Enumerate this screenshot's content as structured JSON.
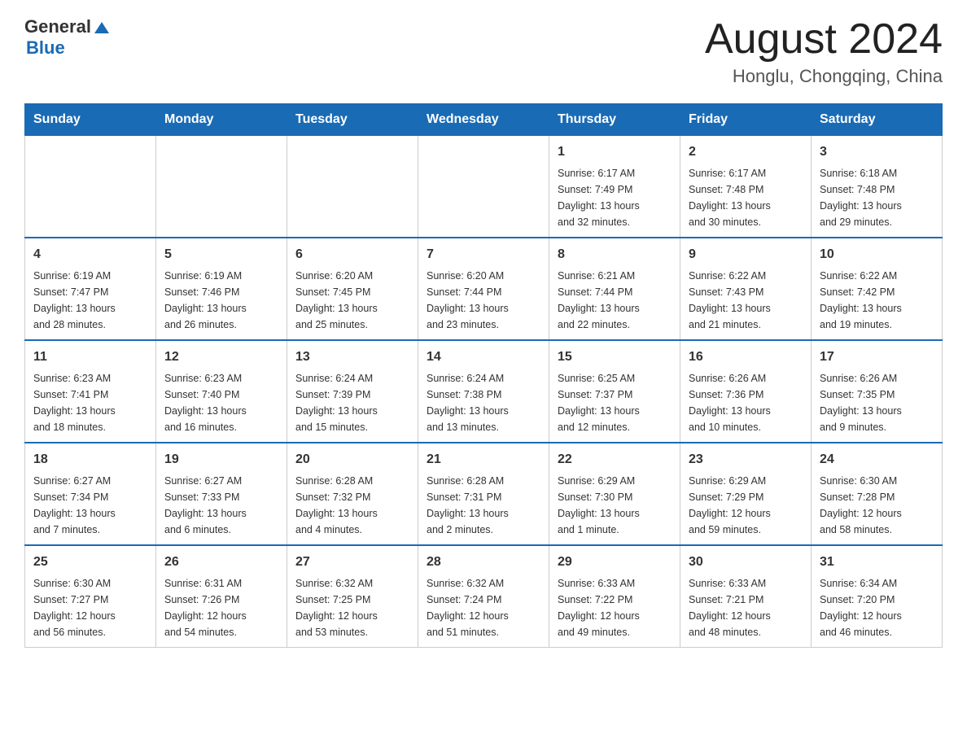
{
  "header": {
    "logo_general": "General",
    "logo_arrow": "▶",
    "logo_blue": "Blue",
    "title": "August 2024",
    "subtitle": "Honglu, Chongqing, China"
  },
  "calendar": {
    "days_of_week": [
      "Sunday",
      "Monday",
      "Tuesday",
      "Wednesday",
      "Thursday",
      "Friday",
      "Saturday"
    ],
    "weeks": [
      [
        {
          "day": "",
          "info": ""
        },
        {
          "day": "",
          "info": ""
        },
        {
          "day": "",
          "info": ""
        },
        {
          "day": "",
          "info": ""
        },
        {
          "day": "1",
          "info": "Sunrise: 6:17 AM\nSunset: 7:49 PM\nDaylight: 13 hours\nand 32 minutes."
        },
        {
          "day": "2",
          "info": "Sunrise: 6:17 AM\nSunset: 7:48 PM\nDaylight: 13 hours\nand 30 minutes."
        },
        {
          "day": "3",
          "info": "Sunrise: 6:18 AM\nSunset: 7:48 PM\nDaylight: 13 hours\nand 29 minutes."
        }
      ],
      [
        {
          "day": "4",
          "info": "Sunrise: 6:19 AM\nSunset: 7:47 PM\nDaylight: 13 hours\nand 28 minutes."
        },
        {
          "day": "5",
          "info": "Sunrise: 6:19 AM\nSunset: 7:46 PM\nDaylight: 13 hours\nand 26 minutes."
        },
        {
          "day": "6",
          "info": "Sunrise: 6:20 AM\nSunset: 7:45 PM\nDaylight: 13 hours\nand 25 minutes."
        },
        {
          "day": "7",
          "info": "Sunrise: 6:20 AM\nSunset: 7:44 PM\nDaylight: 13 hours\nand 23 minutes."
        },
        {
          "day": "8",
          "info": "Sunrise: 6:21 AM\nSunset: 7:44 PM\nDaylight: 13 hours\nand 22 minutes."
        },
        {
          "day": "9",
          "info": "Sunrise: 6:22 AM\nSunset: 7:43 PM\nDaylight: 13 hours\nand 21 minutes."
        },
        {
          "day": "10",
          "info": "Sunrise: 6:22 AM\nSunset: 7:42 PM\nDaylight: 13 hours\nand 19 minutes."
        }
      ],
      [
        {
          "day": "11",
          "info": "Sunrise: 6:23 AM\nSunset: 7:41 PM\nDaylight: 13 hours\nand 18 minutes."
        },
        {
          "day": "12",
          "info": "Sunrise: 6:23 AM\nSunset: 7:40 PM\nDaylight: 13 hours\nand 16 minutes."
        },
        {
          "day": "13",
          "info": "Sunrise: 6:24 AM\nSunset: 7:39 PM\nDaylight: 13 hours\nand 15 minutes."
        },
        {
          "day": "14",
          "info": "Sunrise: 6:24 AM\nSunset: 7:38 PM\nDaylight: 13 hours\nand 13 minutes."
        },
        {
          "day": "15",
          "info": "Sunrise: 6:25 AM\nSunset: 7:37 PM\nDaylight: 13 hours\nand 12 minutes."
        },
        {
          "day": "16",
          "info": "Sunrise: 6:26 AM\nSunset: 7:36 PM\nDaylight: 13 hours\nand 10 minutes."
        },
        {
          "day": "17",
          "info": "Sunrise: 6:26 AM\nSunset: 7:35 PM\nDaylight: 13 hours\nand 9 minutes."
        }
      ],
      [
        {
          "day": "18",
          "info": "Sunrise: 6:27 AM\nSunset: 7:34 PM\nDaylight: 13 hours\nand 7 minutes."
        },
        {
          "day": "19",
          "info": "Sunrise: 6:27 AM\nSunset: 7:33 PM\nDaylight: 13 hours\nand 6 minutes."
        },
        {
          "day": "20",
          "info": "Sunrise: 6:28 AM\nSunset: 7:32 PM\nDaylight: 13 hours\nand 4 minutes."
        },
        {
          "day": "21",
          "info": "Sunrise: 6:28 AM\nSunset: 7:31 PM\nDaylight: 13 hours\nand 2 minutes."
        },
        {
          "day": "22",
          "info": "Sunrise: 6:29 AM\nSunset: 7:30 PM\nDaylight: 13 hours\nand 1 minute."
        },
        {
          "day": "23",
          "info": "Sunrise: 6:29 AM\nSunset: 7:29 PM\nDaylight: 12 hours\nand 59 minutes."
        },
        {
          "day": "24",
          "info": "Sunrise: 6:30 AM\nSunset: 7:28 PM\nDaylight: 12 hours\nand 58 minutes."
        }
      ],
      [
        {
          "day": "25",
          "info": "Sunrise: 6:30 AM\nSunset: 7:27 PM\nDaylight: 12 hours\nand 56 minutes."
        },
        {
          "day": "26",
          "info": "Sunrise: 6:31 AM\nSunset: 7:26 PM\nDaylight: 12 hours\nand 54 minutes."
        },
        {
          "day": "27",
          "info": "Sunrise: 6:32 AM\nSunset: 7:25 PM\nDaylight: 12 hours\nand 53 minutes."
        },
        {
          "day": "28",
          "info": "Sunrise: 6:32 AM\nSunset: 7:24 PM\nDaylight: 12 hours\nand 51 minutes."
        },
        {
          "day": "29",
          "info": "Sunrise: 6:33 AM\nSunset: 7:22 PM\nDaylight: 12 hours\nand 49 minutes."
        },
        {
          "day": "30",
          "info": "Sunrise: 6:33 AM\nSunset: 7:21 PM\nDaylight: 12 hours\nand 48 minutes."
        },
        {
          "day": "31",
          "info": "Sunrise: 6:34 AM\nSunset: 7:20 PM\nDaylight: 12 hours\nand 46 minutes."
        }
      ]
    ]
  }
}
